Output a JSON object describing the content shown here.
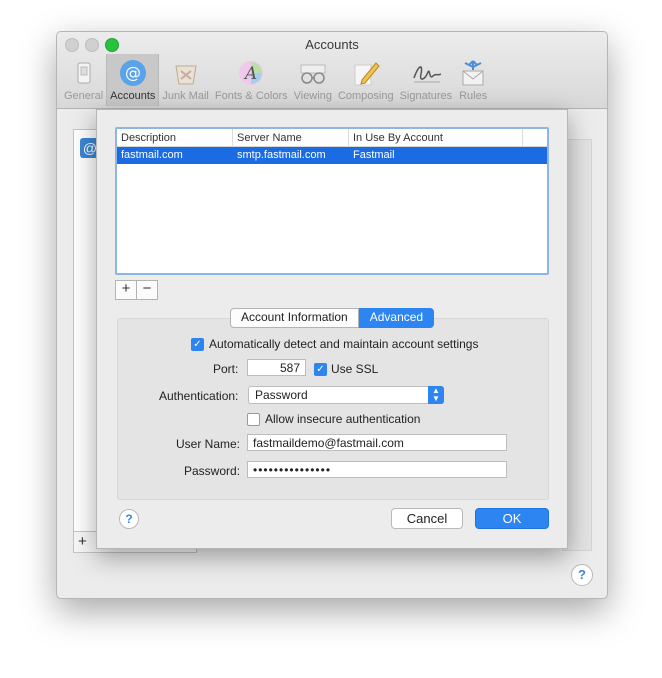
{
  "window": {
    "title": "Accounts"
  },
  "toolbar": {
    "items": [
      {
        "label": "General",
        "icon": "general-switch-icon"
      },
      {
        "label": "Accounts",
        "icon": "at-sign-icon"
      },
      {
        "label": "Junk Mail",
        "icon": "junk-mail-icon"
      },
      {
        "label": "Fonts & Colors",
        "icon": "fonts-colors-icon"
      },
      {
        "label": "Viewing",
        "icon": "glasses-icon"
      },
      {
        "label": "Composing",
        "icon": "pencil-icon"
      },
      {
        "label": "Signatures",
        "icon": "signature-icon"
      },
      {
        "label": "Rules",
        "icon": "rules-envelope-icon"
      }
    ],
    "active": "Accounts"
  },
  "table": {
    "headers": [
      "Description",
      "Server Name",
      "In Use By Account"
    ],
    "rows": [
      {
        "description": "fastmail.com",
        "server": "smtp.fastmail.com",
        "account": "Fastmail"
      }
    ]
  },
  "tabs": [
    "Account Information",
    "Advanced"
  ],
  "form": {
    "auto_detect_label": "Automatically detect and maintain account settings",
    "port_label": "Port:",
    "port_value": "587",
    "ssl_label": "Use SSL",
    "auth_label": "Authentication:",
    "auth_value": "Password",
    "insecure_label": "Allow insecure authentication",
    "user_label": "User Name:",
    "user_value": "fastmaildemo@fastmail.com",
    "password_label": "Password:",
    "password_value": "•••••••••••••••"
  },
  "buttons": {
    "cancel": "Cancel",
    "ok": "OK",
    "plus": "+",
    "minus": "−",
    "help": "?"
  },
  "colors": {
    "accent": "#2d85f2",
    "selection": "#1b6ce3"
  }
}
